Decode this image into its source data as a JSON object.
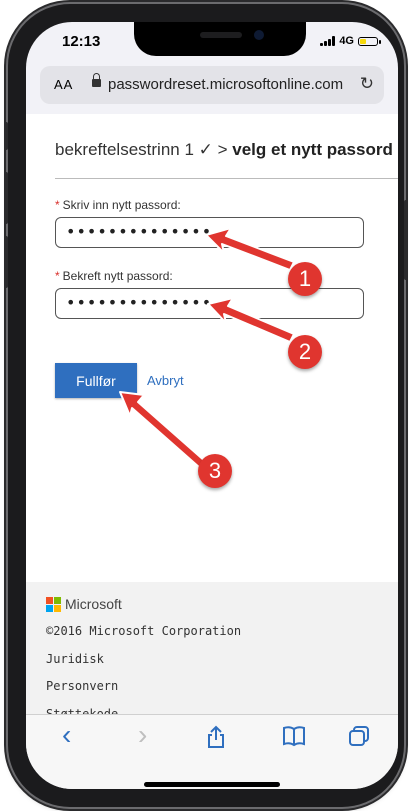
{
  "status_bar": {
    "time": "12:13",
    "network": "4G"
  },
  "browser": {
    "text_size_label": "AA",
    "url": "passwordreset.microsoftonline.com"
  },
  "page": {
    "steps_prefix": "bekreftelsestrinn 1 ✓ > ",
    "steps_current": "velg et nytt passord",
    "new_password_label": "Skriv inn nytt passord:",
    "new_password_value": "••••••••••••••",
    "confirm_password_label": "Bekreft nytt passord:",
    "confirm_password_value": "••••••••••••••",
    "finish_button": "Fullfør",
    "cancel_link": "Avbryt"
  },
  "annotations": [
    "1",
    "2",
    "3"
  ],
  "footer": {
    "brand": "Microsoft",
    "copyright": "©2016 Microsoft Corporation",
    "links": [
      "Juridisk",
      "Personvern",
      "Støttekode"
    ]
  },
  "toolbar": {
    "back_icon": "‹",
    "forward_icon": "›",
    "share_icon": "share-icon",
    "bookmarks_icon": "book-icon",
    "tabs_icon": "tabs-icon"
  },
  "colors": {
    "accent": "#2f6fbf",
    "annotation": "#e0352f",
    "required_star": "#d9302c",
    "ms_red": "#f25022",
    "ms_green": "#7fba00",
    "ms_blue": "#00a4ef",
    "ms_yellow": "#ffb900"
  }
}
